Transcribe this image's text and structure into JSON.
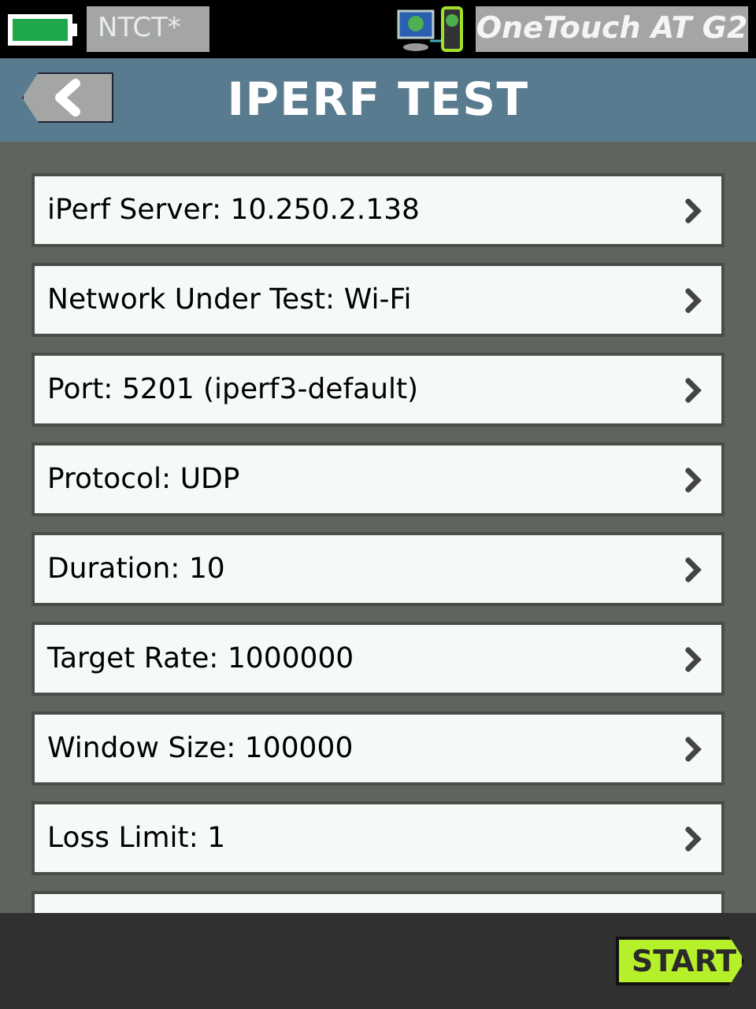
{
  "status_bar": {
    "profile": "NTCT*",
    "device": "OneTouch AT G2"
  },
  "header": {
    "title": "IPERF TEST"
  },
  "settings": [
    {
      "label": "iPerf Server: 10.250.2.138"
    },
    {
      "label": "Network Under Test: Wi-Fi"
    },
    {
      "label": "Port: 5201 (iperf3-default)"
    },
    {
      "label": "Protocol: UDP"
    },
    {
      "label": "Duration: 10"
    },
    {
      "label": "Target Rate: 1000000"
    },
    {
      "label": "Window Size: 100000"
    },
    {
      "label": "Loss Limit: 1"
    }
  ],
  "footer": {
    "start_button": "START"
  }
}
